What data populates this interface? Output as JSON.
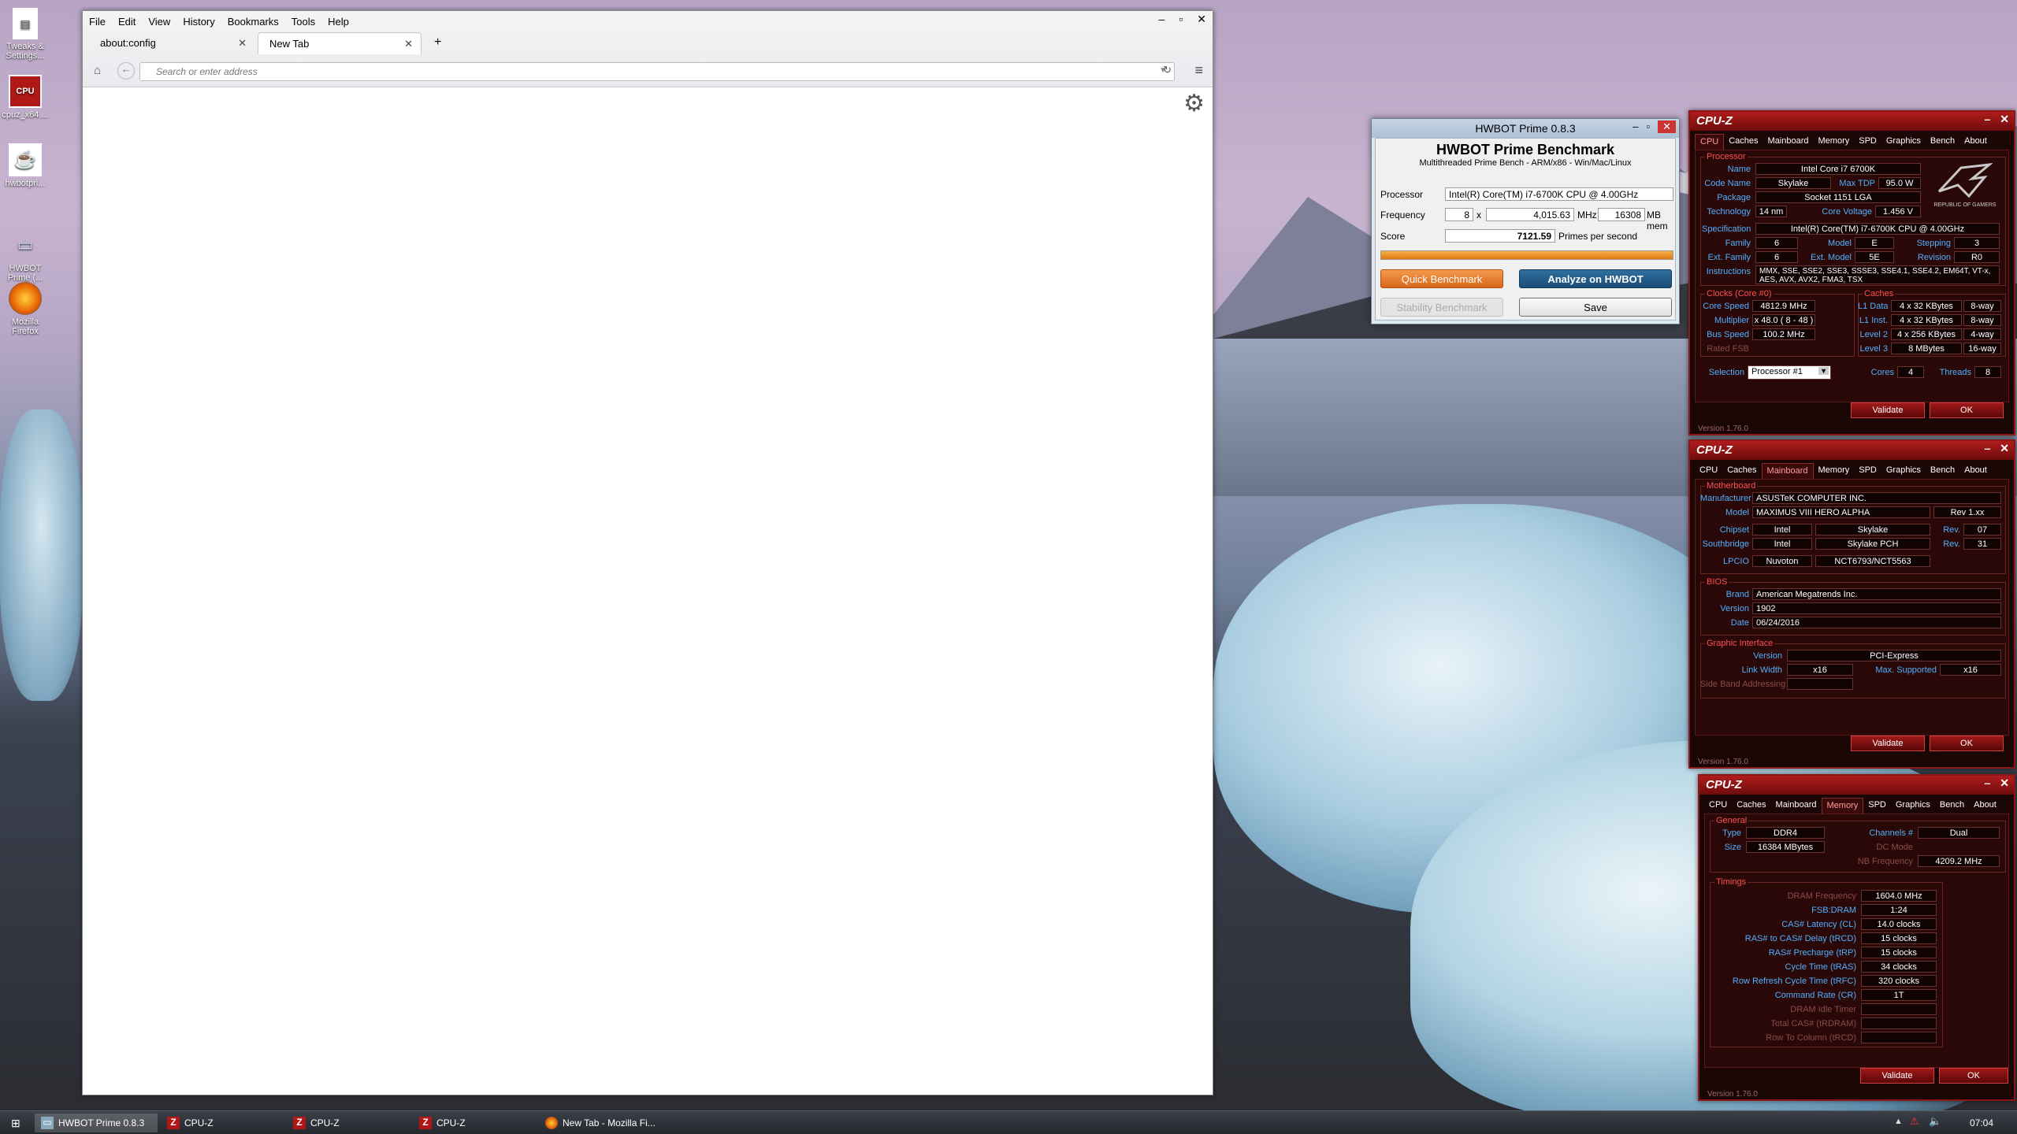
{
  "desktop": {
    "icons": [
      {
        "label": "Tweaks & Settings...",
        "icon": "document-icon"
      },
      {
        "label": "cpuz_x64....",
        "icon": "cpuz-icon"
      },
      {
        "label": "hwbotpri...",
        "icon": "java-icon"
      },
      {
        "label": "HWBOT Prime (...",
        "icon": "hwbot-icon"
      },
      {
        "label": "Mozilla Firefox",
        "icon": "firefox-icon"
      }
    ]
  },
  "firefox": {
    "menu": [
      "File",
      "Edit",
      "View",
      "History",
      "Bookmarks",
      "Tools",
      "Help"
    ],
    "tabs": [
      {
        "label": "about:config"
      },
      {
        "label": "New Tab"
      }
    ],
    "new_tab": "+",
    "url_placeholder": "Search or enter address"
  },
  "hwbot": {
    "title": "HWBOT Prime 0.8.3",
    "heading": "HWBOT Prime Benchmark",
    "subheading": "Multithreaded Prime Bench - ARM/x86 - Win/Mac/Linux",
    "processor_label": "Processor",
    "processor": "Intel(R) Core(TM) i7-6700K CPU @ 4.00GHz",
    "frequency_label": "Frequency",
    "threads": "8",
    "x": "x",
    "mhz_value": "4,015.63",
    "mhz": "MHz",
    "mem_value": "16308",
    "mem": "MB mem",
    "score_label": "Score",
    "score": "7121.59",
    "score_unit": "Primes per second",
    "progress": 1.0,
    "quick": "Quick Benchmark",
    "analyze": "Analyze on HWBOT",
    "stability": "Stability Benchmark",
    "save": "Save"
  },
  "cpuz1": {
    "title": "CPU-Z",
    "tabs": [
      "CPU",
      "Caches",
      "Mainboard",
      "Memory",
      "SPD",
      "Graphics",
      "Bench",
      "About"
    ],
    "processor_group": "Processor",
    "name_k": "Name",
    "name": "Intel Core i7 6700K",
    "code_k": "Code Name",
    "code": "Skylake",
    "tdp_k": "Max TDP",
    "tdp": "95.0 W",
    "package_k": "Package",
    "package": "Socket 1151 LGA",
    "tech_k": "Technology",
    "tech": "14 nm",
    "cv_k": "Core Voltage",
    "cv": "1.456 V",
    "spec_k": "Specification",
    "spec": "Intel(R) Core(TM) i7-6700K CPU @ 4.00GHz",
    "family_k": "Family",
    "family": "6",
    "model_k": "Model",
    "model": "E",
    "stepping_k": "Stepping",
    "stepping": "3",
    "extfam_k": "Ext. Family",
    "extfam": "6",
    "extmod_k": "Ext. Model",
    "extmod": "5E",
    "rev_k": "Revision",
    "rev": "R0",
    "instr_k": "Instructions",
    "instr": "MMX, SSE, SSE2, SSE3, SSSE3, SSE4.1, SSE4.2, EM64T, VT-x, AES, AVX, AVX2, FMA3, TSX",
    "clocks_group": "Clocks (Core #0)",
    "caches_group": "Caches",
    "cs_k": "Core Speed",
    "cs": "4812.9 MHz",
    "mul_k": "Multiplier",
    "mul": "x 48.0 ( 8 - 48 )",
    "bus_k": "Bus Speed",
    "bus": "100.2 MHz",
    "fsb_k": "Rated FSB",
    "l1d_k": "L1 Data",
    "l1d": "4 x 32 KBytes",
    "l1d_w": "8-way",
    "l1i_k": "L1 Inst.",
    "l1i": "4 x 32 KBytes",
    "l1i_w": "8-way",
    "l2_k": "Level 2",
    "l2": "4 x 256 KBytes",
    "l2_w": "4-way",
    "l3_k": "Level 3",
    "l3": "8 MBytes",
    "l3_w": "16-way",
    "sel_k": "Selection",
    "sel": "Processor #1",
    "cores_k": "Cores",
    "cores": "4",
    "threads_k": "Threads",
    "threads": "8",
    "validate": "Validate",
    "ok": "OK",
    "version": "Version 1.76.0",
    "logo": "REPUBLIC OF GAMERS"
  },
  "cpuz2": {
    "title": "CPU-Z",
    "tabs": [
      "CPU",
      "Caches",
      "Mainboard",
      "Memory",
      "SPD",
      "Graphics",
      "Bench",
      "About"
    ],
    "mb_group": "Motherboard",
    "man_k": "Manufacturer",
    "man": "ASUSTeK COMPUTER INC.",
    "model_k": "Model",
    "model": "MAXIMUS VIII HERO ALPHA",
    "model_rev": "Rev 1.xx",
    "chip_k": "Chipset",
    "chip1": "Intel",
    "chip2": "Skylake",
    "chip_rev_k": "Rev.",
    "chip_rev": "07",
    "sb_k": "Southbridge",
    "sb1": "Intel",
    "sb2": "Skylake PCH",
    "sb_rev_k": "Rev.",
    "sb_rev": "31",
    "lpc_k": "LPCIO",
    "lpc1": "Nuvoton",
    "lpc2": "NCT6793/NCT5563",
    "bios_group": "BIOS",
    "brand_k": "Brand",
    "brand": "American Megatrends Inc.",
    "ver_k": "Version",
    "ver": "1902",
    "date_k": "Date",
    "date": "06/24/2016",
    "gi_group": "Graphic Interface",
    "giv_k": "Version",
    "giv": "PCI-Express",
    "lw_k": "Link Width",
    "lw": "x16",
    "ms_k": "Max. Supported",
    "ms": "x16",
    "sba_k": "Side Band Addressing",
    "validate": "Validate",
    "ok": "OK",
    "version": "Version 1.76.0"
  },
  "cpuz3": {
    "title": "CPU-Z",
    "tabs": [
      "CPU",
      "Caches",
      "Mainboard",
      "Memory",
      "SPD",
      "Graphics",
      "Bench",
      "About"
    ],
    "gen_group": "General",
    "type_k": "Type",
    "type": "DDR4",
    "ch_k": "Channels #",
    "ch": "Dual",
    "size_k": "Size",
    "size": "16384 MBytes",
    "dc_k": "DC Mode",
    "nb_k": "NB Frequency",
    "nb": "4209.2 MHz",
    "tim_group": "Timings",
    "timings": [
      {
        "k": "DRAM Frequency",
        "v": "1604.0 MHz",
        "dim": true
      },
      {
        "k": "FSB:DRAM",
        "v": "1:24",
        "dim": false
      },
      {
        "k": "CAS# Latency (CL)",
        "v": "14.0 clocks",
        "dim": false
      },
      {
        "k": "RAS# to CAS# Delay (tRCD)",
        "v": "15 clocks",
        "dim": false
      },
      {
        "k": "RAS# Precharge (tRP)",
        "v": "15 clocks",
        "dim": false
      },
      {
        "k": "Cycle Time (tRAS)",
        "v": "34 clocks",
        "dim": false
      },
      {
        "k": "Row Refresh Cycle Time (tRFC)",
        "v": "320 clocks",
        "dim": false
      },
      {
        "k": "Command Rate (CR)",
        "v": "1T",
        "dim": false
      },
      {
        "k": "DRAM Idle Timer",
        "v": "",
        "dim": true
      },
      {
        "k": "Total CAS# (tRDRAM)",
        "v": "",
        "dim": true
      },
      {
        "k": "Row To Column (tRCD)",
        "v": "",
        "dim": true
      }
    ],
    "validate": "Validate",
    "ok": "OK",
    "version": "Version 1.76.0"
  },
  "taskbar": {
    "items": [
      {
        "label": "HWBOT Prime 0.8.3",
        "icon": "hwbot-icon"
      },
      {
        "label": "CPU-Z",
        "icon": "cpuz-icon"
      },
      {
        "label": "CPU-Z",
        "icon": "cpuz-icon"
      },
      {
        "label": "CPU-Z",
        "icon": "cpuz-icon"
      },
      {
        "label": "New Tab - Mozilla Fi...",
        "icon": "firefox-icon"
      }
    ],
    "clock": "07:04"
  }
}
